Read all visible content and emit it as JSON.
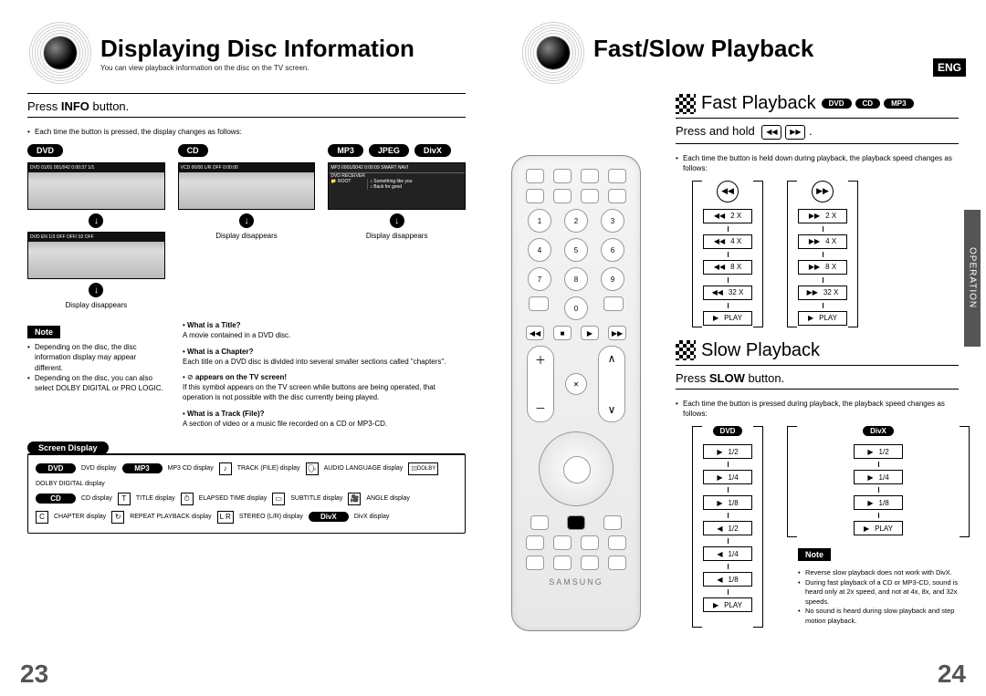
{
  "lang_badge": "ENG",
  "side_tab": "OPERATION",
  "page_left_num": "23",
  "page_right_num": "24",
  "left": {
    "title": "Displaying Disc Information",
    "subtitle": "You can view playback information on the disc on the TV screen.",
    "instruction_pre": "Press ",
    "instruction_bold": "INFO",
    "instruction_post": " button.",
    "press_note": "Each time the button is pressed, the display changes as follows:",
    "cols": {
      "dvd_label": "DVD",
      "cd_label": "CD",
      "mp3_label": "MP3",
      "jpeg_label": "JPEG",
      "divx_label": "DivX"
    },
    "display_disappears": "Display disappears",
    "scr_dvd1": "DVD   01/01  001/042  0:00:37  1/1",
    "scr_dvd2": "DVD  EN 1/3  OFF  OFF/ 02  OFF",
    "scr_cd": "VCD  00/00  L/R  OFF  0:00:00",
    "scr_mp3_header": "MP3  0001/0042  0:00:09           SMART NAVI",
    "scr_mp3_root": "ROOT",
    "scr_mp3_item1": "Something like you",
    "scr_mp3_item2": "Back for good",
    "note_label": "Note",
    "note_items": [
      "Depending on the disc, the disc information display may appear different.",
      "Depending on the disc, you can also select DOLBY DIGITAL or PRO LOGIC."
    ],
    "defs": {
      "t1": "What is a Title?",
      "d1": "A movie contained in a DVD disc.",
      "t2": "What is a Chapter?",
      "d2": "Each title on a DVD disc is divided into several smaller sections called \"chapters\".",
      "t3_icon": "⊘",
      "t3": "appears on the TV screen!",
      "d3": "If this symbol appears on the TV screen while buttons are being operated, that operation is not possible with the disc currently being played.",
      "t4": "What is a Track (File)?",
      "d4": "A section of video or a music file recorded on a CD or MP3-CD."
    },
    "screen_display_label": "Screen Display",
    "sd": {
      "dvd": "DVD",
      "dvd_t": "DVD display",
      "mp3": "MP3",
      "mp3_t": "MP3 CD display",
      "track_t": "TRACK (FILE) display",
      "audio_t": "AUDIO LANGUAGE display",
      "dolby_t": "DOLBY DIGITAL display",
      "cd": "CD",
      "cd_t": "CD display",
      "title_t": "TITLE display",
      "elapsed_t": "ELAPSED TIME display",
      "sub_t": "SUBTITLE display",
      "angle_t": "ANGLE display",
      "chapter_t": "CHAPTER display",
      "repeat_t": "REPEAT PLAYBACK display",
      "lr": "L R",
      "lr_t": "STEREO (L/R) display",
      "divx": "DivX",
      "divx_t": "DivX display"
    }
  },
  "right": {
    "title": "Fast/Slow Playback",
    "fast": {
      "heading": "Fast Playback",
      "badges": [
        "DVD",
        "CD",
        "MP3"
      ],
      "instruction_pre": "Press and hold ",
      "press_note": "Each time the button is held down during playback, the playback speed changes as follows:",
      "rew": [
        "2 X",
        "4 X",
        "8 X",
        "32 X",
        "PLAY"
      ],
      "fwd": [
        "2 X",
        "4 X",
        "8 X",
        "32 X",
        "PLAY"
      ]
    },
    "slow": {
      "heading": "Slow Playback",
      "instruction_pre": "Press  ",
      "instruction_bold": "SLOW",
      "instruction_post": " button.",
      "press_note": "Each time the button is pressed during playback, the playback speed changes as follows:",
      "dvd_label": "DVD",
      "divx_label": "DivX",
      "dvd_steps": [
        "1/2",
        "1/4",
        "1/8",
        "1/2",
        "1/4",
        "1/8",
        "PLAY"
      ],
      "divx_steps": [
        "1/2",
        "1/4",
        "1/8",
        "PLAY"
      ],
      "note_label": "Note",
      "note_items": [
        "Reverse slow playback does not work with DivX.",
        "During fast playback of a CD or MP3-CD, sound is heard only at 2x speed, and not at 4x, 8x, and 32x speeds.",
        "No sound is heard during slow playback and step motion playback."
      ]
    }
  },
  "remote_logo": "SAMSUNG"
}
